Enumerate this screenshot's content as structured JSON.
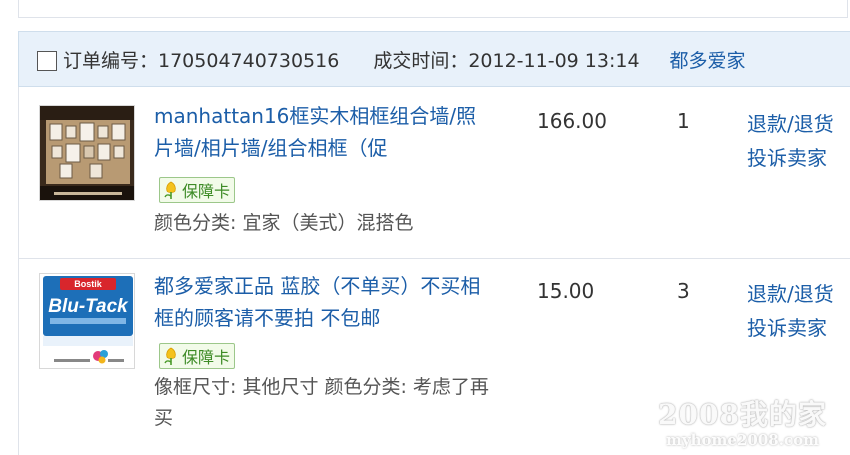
{
  "order": {
    "order_no_label": "订单编号：170504740730516",
    "deal_time_label": "成交时间：2012-11-09 13:14",
    "seller": "都多爱家"
  },
  "items": [
    {
      "title": "manhattan16框实木相框组合墙/照片墙/相片墙/组合相框（促",
      "badge": "保障卡",
      "attrs": "颜色分类: 宜家（美式）混搭色",
      "price": "166.00",
      "qty": "1",
      "action_refund": "退款/退货",
      "action_complain": "投诉卖家",
      "thumb_icon": "photo-wall-thumbnail"
    },
    {
      "title": "都多爱家正品 蓝胶（不单买）不买相框的顾客请不要拍 不包邮",
      "badge": "保障卡",
      "attrs": "像框尺寸: 其他尺寸 颜色分类: 考虑了再买",
      "price": "15.00",
      "qty": "3",
      "action_refund": "退款/退货",
      "action_complain": "投诉卖家",
      "thumb_icon": "blu-tack-thumbnail"
    }
  ],
  "watermark": {
    "line1": "2008我的家",
    "line2": "myhome2008.com"
  },
  "colors": {
    "link": "#1c5ea8",
    "header_bg": "#e8f1fa",
    "badge_green": "#3d8b26"
  }
}
